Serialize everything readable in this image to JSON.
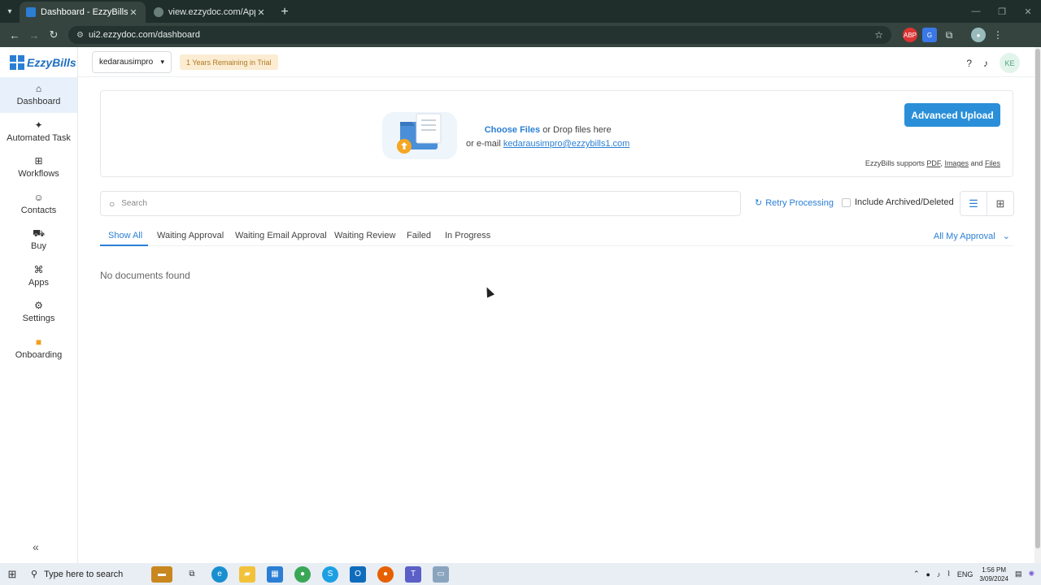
{
  "browser": {
    "tabs": [
      {
        "title": "Dashboard - EzzyBills",
        "active": true
      },
      {
        "title": "view.ezzydoc.com/Approve.asp",
        "active": false
      }
    ],
    "url": "ui2.ezzydoc.com/dashboard",
    "new_tab": "+"
  },
  "app": {
    "brand": "EzzyBills",
    "company": "kedarausimpro",
    "trial_badge": "1 Years Remaining in Trial",
    "avatar": "KE",
    "accent_color": "#2a7fd4"
  },
  "sidebar": {
    "items": [
      {
        "label": "Dashboard",
        "icon": "home-icon",
        "active": true
      },
      {
        "label": "Automated Task",
        "icon": "sparkle-icon",
        "active": false
      },
      {
        "label": "Workflows",
        "icon": "workflow-icon",
        "active": false
      },
      {
        "label": "Contacts",
        "icon": "contacts-icon",
        "active": false
      },
      {
        "label": "Buy",
        "icon": "cart-icon",
        "active": false
      },
      {
        "label": "Apps",
        "icon": "apps-icon",
        "active": false
      },
      {
        "label": "Settings",
        "icon": "gear-icon",
        "active": false
      },
      {
        "label": "Onboarding",
        "icon": "video-icon",
        "active": false
      }
    ],
    "collapse": "«"
  },
  "upload": {
    "choose_files": "Choose Files",
    "drop_text": " or Drop files here",
    "email_prefix": "or e-mail ",
    "email": "kedarausimpro@ezzybills1.com",
    "advanced_button": "Advanced Upload",
    "supports_prefix": "EzzyBills supports ",
    "supports_pdf": "PDF",
    "supports_sep": ", ",
    "supports_images": "Images",
    "supports_and": " and ",
    "supports_files": "Files"
  },
  "filters": {
    "search_placeholder": "Search",
    "retry": "Retry Processing",
    "include_archived": "Include Archived/Deleted"
  },
  "tabs": [
    {
      "label": "Show All",
      "active": true
    },
    {
      "label": "Waiting Approval",
      "active": false
    },
    {
      "label": "Waiting Email Approval",
      "active": false
    },
    {
      "label": "Waiting Review",
      "active": false
    },
    {
      "label": "Failed",
      "active": false
    },
    {
      "label": "In Progress",
      "active": false
    }
  ],
  "approval_filter": "All My Approval",
  "empty_message": "No documents found",
  "taskbar": {
    "search_placeholder": "Type here to search",
    "language": "ENG",
    "time": "1:56 PM",
    "date": "3/09/2024"
  }
}
